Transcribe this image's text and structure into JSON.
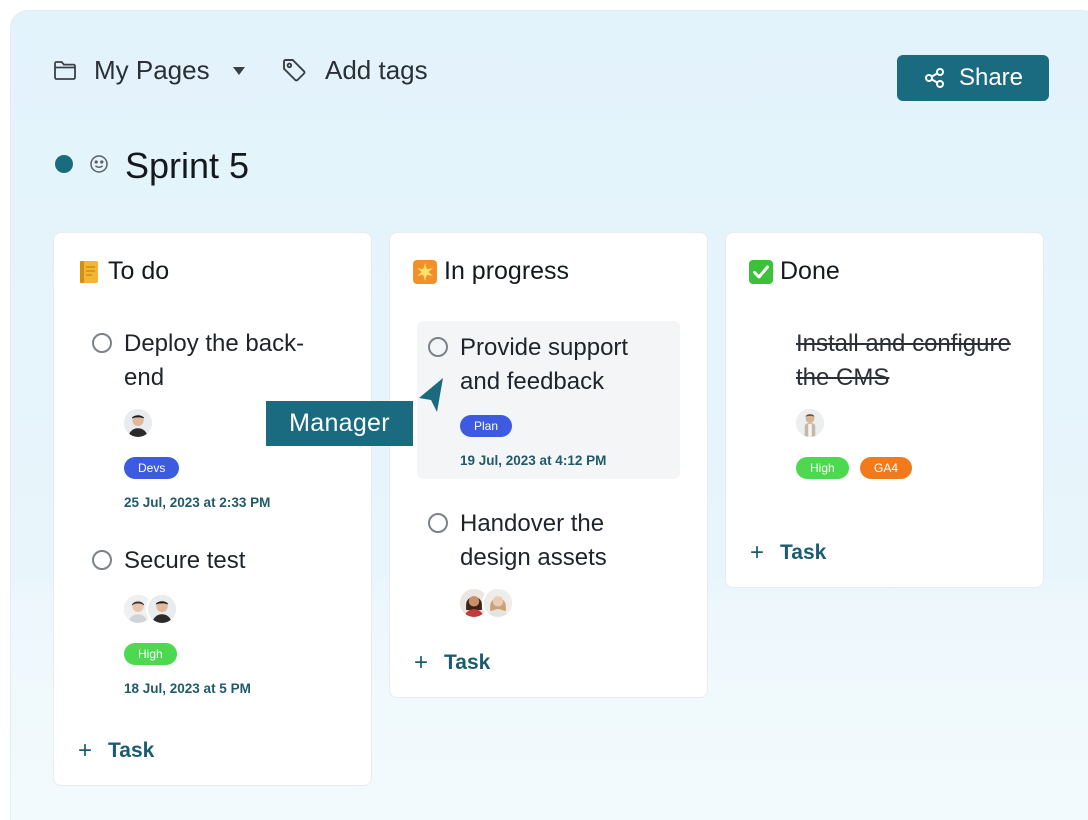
{
  "toolbar": {
    "pages_label": "My Pages",
    "tags_label": "Add tags",
    "share_label": "Share"
  },
  "page": {
    "title": "Sprint 5"
  },
  "columns": [
    {
      "title": "To do",
      "emoji": "notebook",
      "tasks": [
        {
          "title": "Deploy the back-end",
          "badges": [
            "Devs"
          ],
          "date": "25 Jul, 2023 at 2:33 PM",
          "avatars": 1
        },
        {
          "title": "Secure test",
          "badges": [
            "High"
          ],
          "date": "18 Jul, 2023 at 5 PM",
          "avatars": 2
        }
      ],
      "add_label": "Task"
    },
    {
      "title": "In progress",
      "emoji": "sparkle",
      "tasks": [
        {
          "title": "Provide support and feedback",
          "badges": [
            "Plan"
          ],
          "date": "19 Jul, 2023 at 4:12 PM",
          "avatars": 0
        },
        {
          "title": "Handover the design assets",
          "badges": [],
          "date": "",
          "avatars": 2
        }
      ],
      "add_label": "Task"
    },
    {
      "title": "Done",
      "emoji": "check",
      "tasks": [
        {
          "title": "Install and configure the CMS",
          "badges": [
            "High",
            "GA4"
          ],
          "date": "",
          "avatars": 1
        }
      ],
      "add_label": "Task"
    }
  ],
  "cursor_label": "Manager",
  "colors": {
    "accent": "#1b6b80",
    "badge_devs": "#3d5be0",
    "badge_plan": "#3d5be0",
    "badge_high": "#4cd94f",
    "badge_ga4": "#f07a1c"
  },
  "icons": [
    "folder-icon",
    "chevron-down-icon",
    "tag-icon",
    "share-icon",
    "smile-icon",
    "cursor-icon"
  ]
}
